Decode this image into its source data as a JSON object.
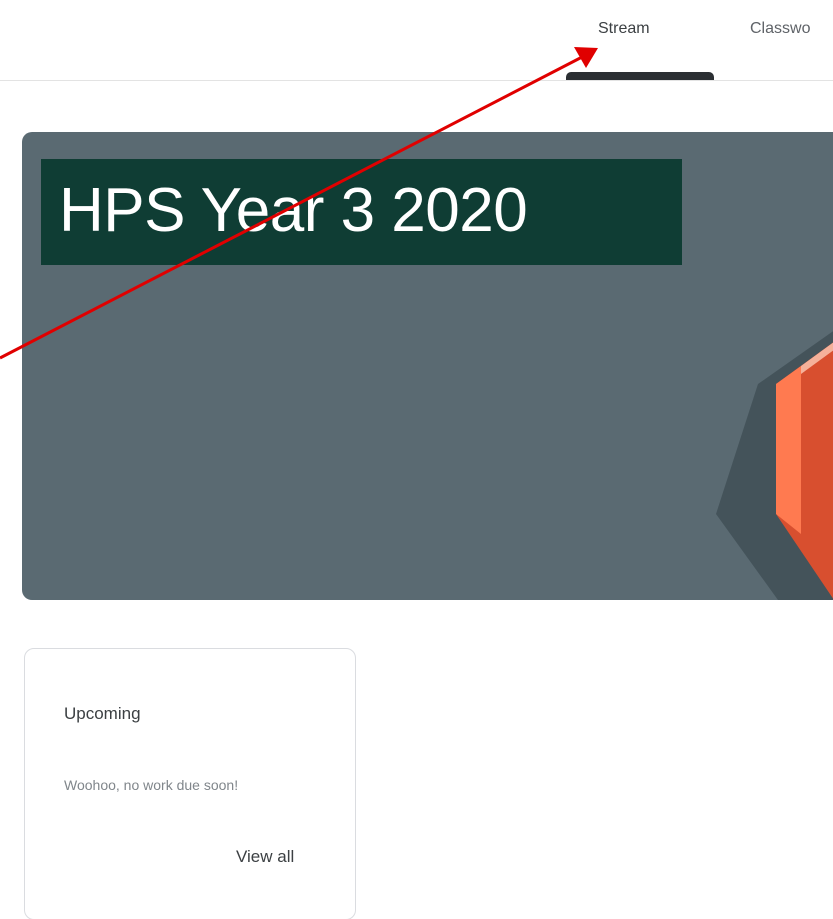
{
  "nav": {
    "tabs": [
      {
        "label": "Stream",
        "active": true
      },
      {
        "label": "Classwo",
        "active": false
      }
    ]
  },
  "banner": {
    "title": "HPS Year 3 2020",
    "background_color": "#5a6a72",
    "title_background_color": "#0f3d34",
    "accent_color": "#e8542e"
  },
  "upcoming": {
    "title": "Upcoming",
    "empty_message": "Woohoo, no work due soon!",
    "view_all_label": "View all"
  },
  "annotation": {
    "arrow_color": "#e00000",
    "points_to": "Stream"
  }
}
